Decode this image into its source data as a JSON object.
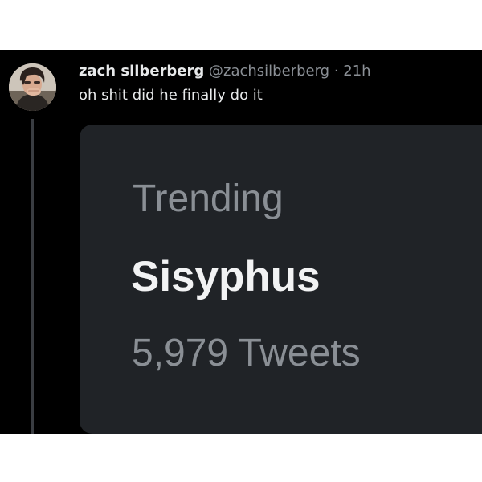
{
  "tweet": {
    "author_name": "zach silberberg",
    "author_handle": "@zachsilberberg",
    "separator": "·",
    "timestamp": "21h",
    "text": "oh shit did he finally do it"
  },
  "trend_card": {
    "label": "Trending",
    "topic": "Sisyphus",
    "count": "5,979 Tweets"
  },
  "colors": {
    "background": "#000000",
    "card_background": "#202327",
    "primary_text": "#e7e9ea",
    "secondary_text": "#8b9096"
  }
}
